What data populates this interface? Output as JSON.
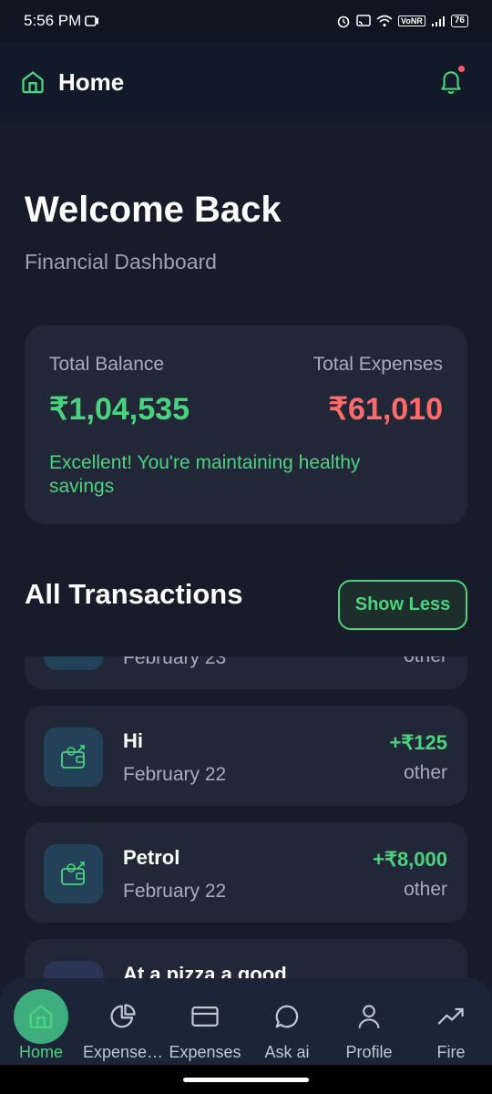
{
  "status_bar": {
    "time": "5:56 PM",
    "network": "VoNR",
    "battery": "76"
  },
  "header": {
    "title": "Home"
  },
  "dashboard": {
    "welcome": "Welcome Back",
    "subtitle": "Financial Dashboard",
    "total_balance_label": "Total Balance",
    "total_balance_value": "₹1,04,535",
    "total_expenses_label": "Total Expenses",
    "total_expenses_value": "₹61,010",
    "health_message": "Excellent! You're maintaining healthy savings"
  },
  "transactions": {
    "section_title": "All Transactions",
    "toggle_label": "Show Less",
    "items": [
      {
        "title": "",
        "date": "February 23",
        "amount": "",
        "category": "other"
      },
      {
        "title": "Hi",
        "date": "February 22",
        "amount": "+₹125",
        "category": "other"
      },
      {
        "title": "Petrol",
        "date": "February 22",
        "amount": "+₹8,000",
        "category": "other"
      },
      {
        "title": "At a pizza a good",
        "date": "",
        "amount": "",
        "category": ""
      }
    ]
  },
  "bottom_nav": {
    "items": [
      {
        "label": "Home",
        "icon": "home-icon",
        "active": true
      },
      {
        "label": "Expense…",
        "icon": "pie-chart-icon",
        "active": false
      },
      {
        "label": "Expenses",
        "icon": "card-icon",
        "active": false
      },
      {
        "label": "Ask ai",
        "icon": "chat-icon",
        "active": false
      },
      {
        "label": "Profile",
        "icon": "user-icon",
        "active": false
      },
      {
        "label": "Fire",
        "icon": "trend-up-icon",
        "active": false
      }
    ]
  },
  "colors": {
    "background": "#171b2a",
    "accent": "#4ad37f",
    "expense": "#ff6b6b",
    "card": "#212737"
  }
}
